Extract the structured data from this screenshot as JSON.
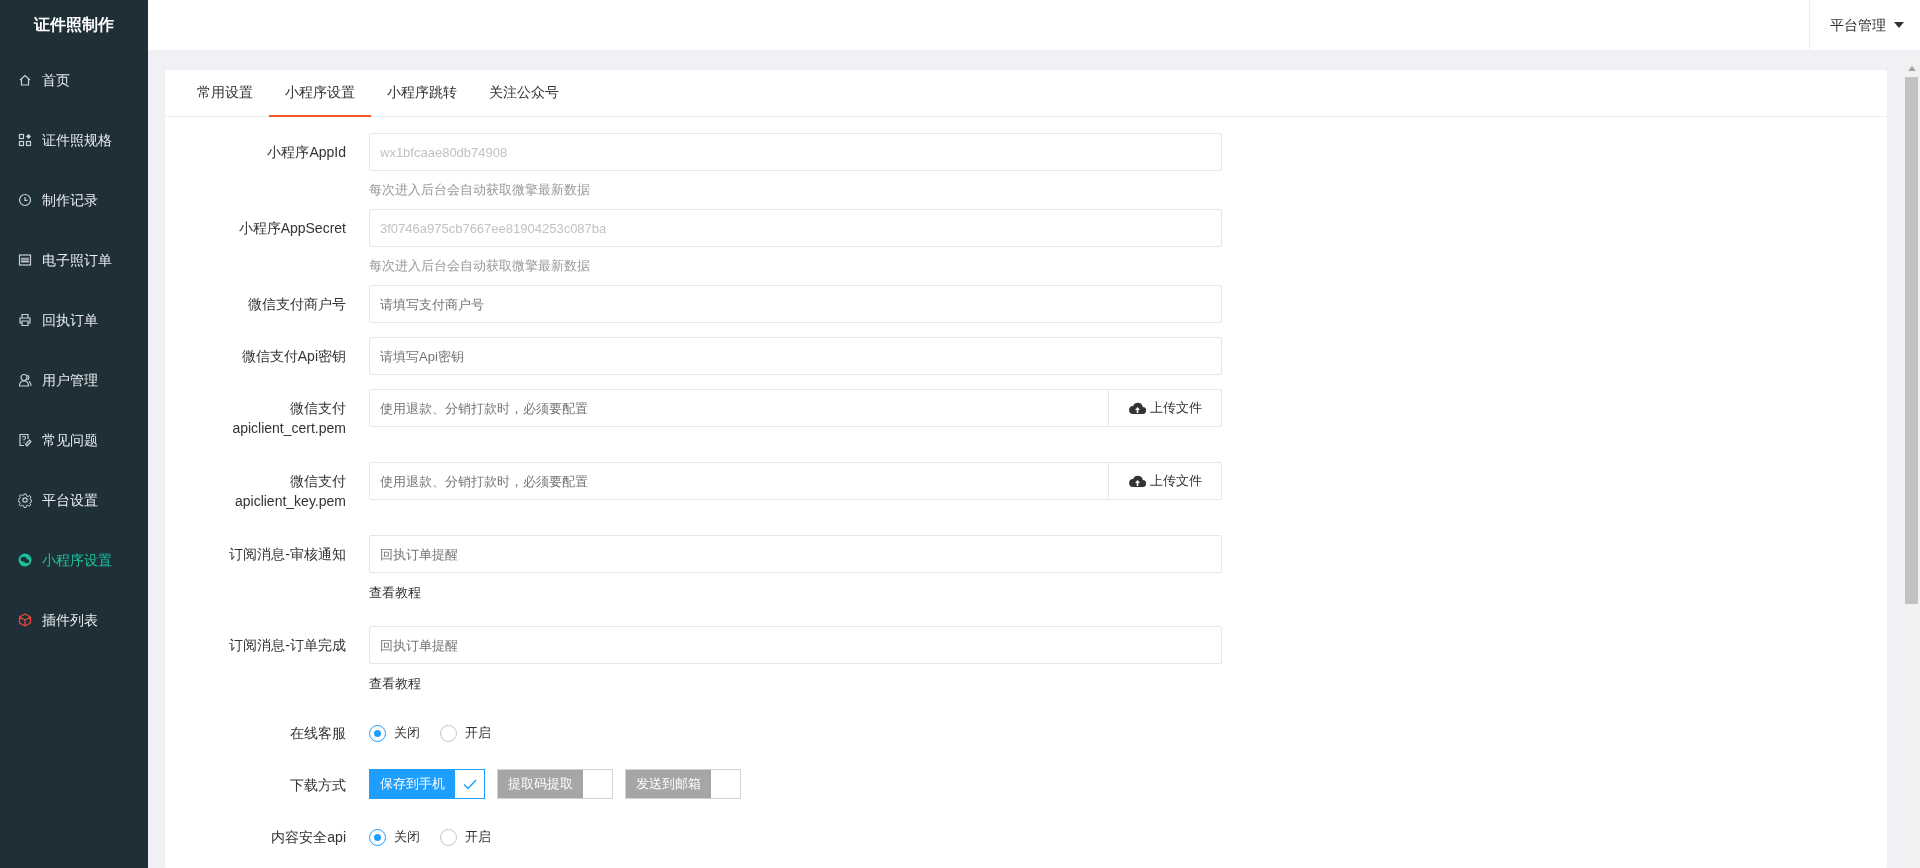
{
  "app": {
    "title": "证件照制作"
  },
  "sidebar": {
    "items": [
      {
        "label": "首页",
        "selected": false
      },
      {
        "label": "证件照规格",
        "selected": false
      },
      {
        "label": "制作记录",
        "selected": false
      },
      {
        "label": "电子照订单",
        "selected": false
      },
      {
        "label": "回执订单",
        "selected": false
      },
      {
        "label": "用户管理",
        "selected": false
      },
      {
        "label": "常见问题",
        "selected": false
      },
      {
        "label": "平台设置",
        "selected": false
      },
      {
        "label": "小程序设置",
        "selected": true
      },
      {
        "label": "插件列表",
        "selected": false
      }
    ]
  },
  "header": {
    "user_menu": "平台管理"
  },
  "tabs": [
    {
      "label": "常用设置",
      "selected": false
    },
    {
      "label": "小程序设置",
      "selected": true
    },
    {
      "label": "小程序跳转",
      "selected": false
    },
    {
      "label": "关注公众号",
      "selected": false
    }
  ],
  "form": [
    {
      "kind": "text",
      "label": [
        "小程序AppId"
      ],
      "placeholder": "wx1bfcaae80db74908",
      "disabled": true,
      "hint": "每次进入后台会自动获取微擎最新数据"
    },
    {
      "kind": "text",
      "label": [
        "小程序AppSecret"
      ],
      "placeholder": "3f0746a975cb7667ee81904253c087ba",
      "disabled": true,
      "hint": "每次进入后台会自动获取微擎最新数据"
    },
    {
      "kind": "text",
      "label": [
        "微信支付商户号"
      ],
      "placeholder": "请填写支付商户号",
      "disabled": false
    },
    {
      "kind": "text",
      "label": [
        "微信支付Api密钥"
      ],
      "placeholder": "请填写Api密钥",
      "disabled": false
    },
    {
      "kind": "file",
      "label": [
        "微信支付",
        "apiclient_cert.pem"
      ],
      "placeholder": "使用退款、分销打款时，必须要配置",
      "button": "上传文件"
    },
    {
      "kind": "file",
      "label": [
        "微信支付",
        "apiclient_key.pem"
      ],
      "placeholder": "使用退款、分销打款时，必须要配置",
      "button": "上传文件"
    },
    {
      "kind": "text",
      "label": [
        "订阅消息-审核通知"
      ],
      "placeholder": "回执订单提醒",
      "disabled": false,
      "link": "查看教程"
    },
    {
      "kind": "text",
      "label": [
        "订阅消息-订单完成"
      ],
      "placeholder": "回执订单提醒",
      "disabled": false,
      "link": "查看教程"
    },
    {
      "kind": "radio",
      "label": [
        "在线客服"
      ],
      "options": [
        {
          "label": "关闭",
          "selected": true
        },
        {
          "label": "开启",
          "selected": false
        }
      ]
    },
    {
      "kind": "checks",
      "label": [
        "下载方式"
      ],
      "options": [
        {
          "label": "保存到手机",
          "checked": true
        },
        {
          "label": "提取码提取",
          "checked": false
        },
        {
          "label": "发送到邮箱",
          "checked": false
        }
      ]
    },
    {
      "kind": "radio",
      "label": [
        "内容安全api"
      ],
      "options": [
        {
          "label": "关闭",
          "selected": true
        },
        {
          "label": "开启",
          "selected": false
        }
      ]
    }
  ]
}
